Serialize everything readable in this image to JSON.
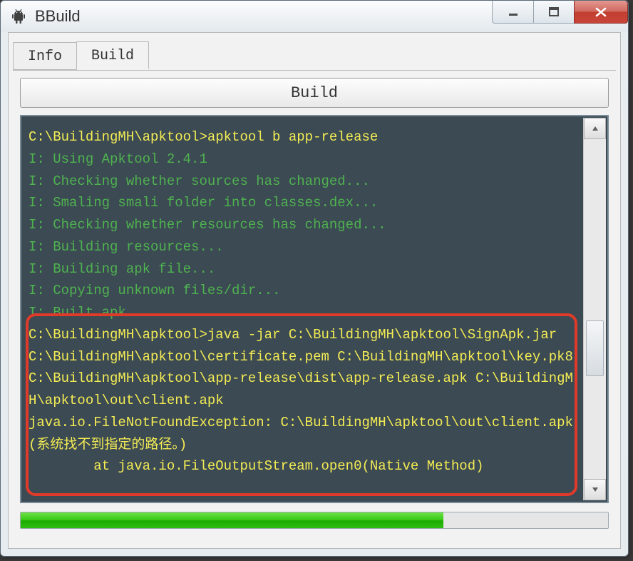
{
  "window": {
    "title": "BBuild"
  },
  "tabs": {
    "info": "Info",
    "build": "Build"
  },
  "buttons": {
    "build": "Build"
  },
  "console": {
    "cmd1": "C:\\BuildingMH\\apktool>apktool b app-release",
    "l1": "I: Using Apktool 2.4.1",
    "l2": "I: Checking whether sources has changed...",
    "l3": "I: Smaling smali folder into classes.dex...",
    "l4": "I: Checking whether resources has changed...",
    "l5": "I: Building resources...",
    "l6": "I: Building apk file...",
    "l7": "I: Copying unknown files/dir...",
    "l8": "I: Built apk...",
    "cmd2": "C:\\BuildingMH\\apktool>java -jar C:\\BuildingMH\\apktool\\SignApk.jar C:\\BuildingMH\\apktool\\certificate.pem C:\\BuildingMH\\apktool\\key.pk8 C:\\BuildingMH\\apktool\\app-release\\dist\\app-release.apk C:\\BuildingMH\\apktool\\out\\client.apk",
    "err1": "java.io.FileNotFoundException: C:\\BuildingMH\\apktool\\out\\client.apk (系统找不到指定的路径。)",
    "err2": "        at java.io.FileOutputStream.open0(Native Method)"
  },
  "progress": {
    "percent": 72
  }
}
